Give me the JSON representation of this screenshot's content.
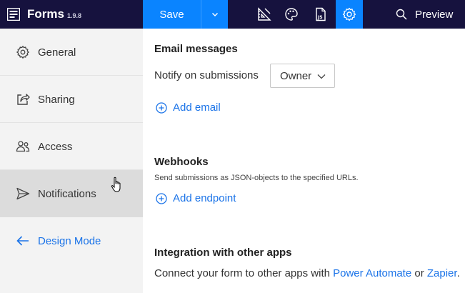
{
  "app": {
    "name": "Forms",
    "version": "1.9.8"
  },
  "toolbar": {
    "save_label": "Save",
    "preview_label": "Preview"
  },
  "sidebar": {
    "items": [
      {
        "label": "General",
        "icon": "gear-icon"
      },
      {
        "label": "Sharing",
        "icon": "share-icon"
      },
      {
        "label": "Access",
        "icon": "users-icon"
      },
      {
        "label": "Notifications",
        "icon": "send-icon"
      },
      {
        "label": "Design Mode",
        "icon": "arrow-left-icon"
      }
    ]
  },
  "email": {
    "title": "Email messages",
    "notify_label": "Notify on submissions",
    "notify_value": "Owner",
    "add_label": "Add email"
  },
  "webhooks": {
    "title": "Webhooks",
    "description": "Send submissions as JSON-objects to the specified URLs.",
    "add_label": "Add endpoint"
  },
  "integration": {
    "title": "Integration with other apps",
    "text_before": "Connect your form to other apps with ",
    "link1": "Power Automate",
    "text_middle": " or ",
    "link2": "Zapier",
    "text_after": "."
  },
  "colors": {
    "topbar": "#16123e",
    "accent": "#0a84ff",
    "link": "#1a73e8",
    "sidebar": "#f3f3f3",
    "selected": "#dcdcdc"
  }
}
